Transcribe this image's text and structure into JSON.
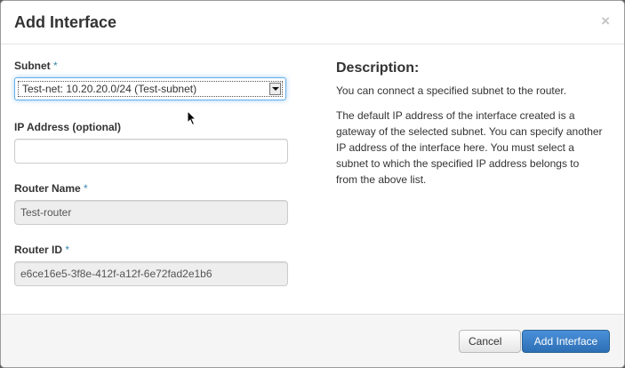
{
  "modal": {
    "title": "Add Interface",
    "close_glyph": "×"
  },
  "form": {
    "subnet": {
      "label": "Subnet",
      "required_mark": "*",
      "selected_value": "Test-net: 10.20.20.0/24 (Test-subnet)"
    },
    "ip_address": {
      "label": "IP Address (optional)",
      "value": ""
    },
    "router_name": {
      "label": "Router Name",
      "required_mark": "*",
      "value": "Test-router"
    },
    "router_id": {
      "label": "Router ID",
      "required_mark": "*",
      "value": "e6ce16e5-3f8e-412f-a12f-6e72fad2e1b6"
    }
  },
  "description": {
    "title": "Description:",
    "paragraphs": [
      "You can connect a specified subnet to the router.",
      "The default IP address of the interface created is a gateway of the selected subnet. You can specify another IP address of the interface here. You must select a subnet to which the specified IP address belongs to from the above list."
    ]
  },
  "footer": {
    "cancel_label": "Cancel",
    "submit_label": "Add Interface"
  },
  "icons": {
    "close": "close-icon",
    "dropdown": "chevron-down-icon",
    "cursor": "mouse-pointer-icon"
  },
  "colors": {
    "primary": "#3071a9",
    "required": "#3a87ad",
    "focus": "#66afe9"
  }
}
